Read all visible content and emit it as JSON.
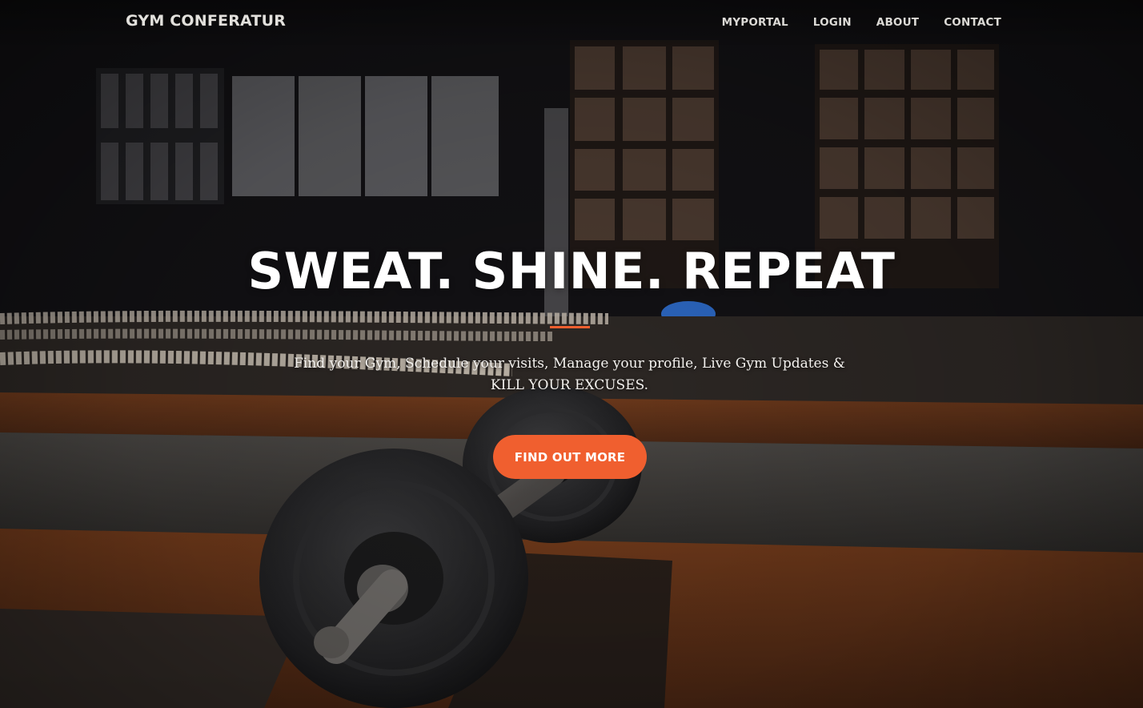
{
  "navbar": {
    "brand": "GYM CONFERATUR",
    "links": [
      {
        "label": "MYPORTAL"
      },
      {
        "label": "LOGIN"
      },
      {
        "label": "ABOUT"
      },
      {
        "label": "CONTACT"
      }
    ]
  },
  "hero": {
    "headline": "SWEAT. SHINE. REPEAT",
    "subtitle": "Find your Gym, Schedule your visits, Manage your profile, Live Gym Updates & KILL YOUR EXCUSES.",
    "cta_label": "FIND OUT MORE",
    "background_image": "gym-floor-barbell-photo"
  },
  "colors": {
    "accent": "#f05f2f",
    "nav_text": "#dcdad6",
    "headline_text": "#ffffff"
  }
}
